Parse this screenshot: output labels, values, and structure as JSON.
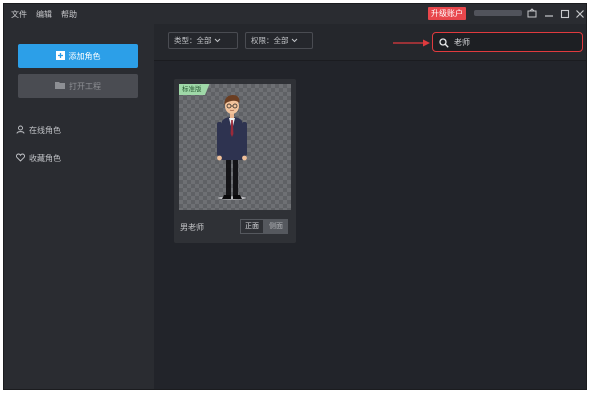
{
  "menu": {
    "file": "文件",
    "edit": "编辑",
    "help": "帮助"
  },
  "titlebar": {
    "upgrade_label": "升级账户"
  },
  "sidebar": {
    "add_button": "添加角色",
    "open_button": "打开工程",
    "online_label": "在线角色",
    "favorites_label": "收藏角色"
  },
  "toolbar": {
    "type_filter": "类型：全部",
    "permission_filter": "权限：全部",
    "search_value": "老师"
  },
  "card": {
    "badge": "标准版",
    "name": "男老师",
    "front_label": "正面",
    "side_label": "侧面"
  },
  "colors": {
    "accent_blue": "#2c9fe8",
    "upgrade_red": "#e8474c",
    "search_border": "#e03a3e",
    "badge_green": "#9fd8a8"
  },
  "annotation": {
    "arrow_color": "#e03a3e"
  }
}
